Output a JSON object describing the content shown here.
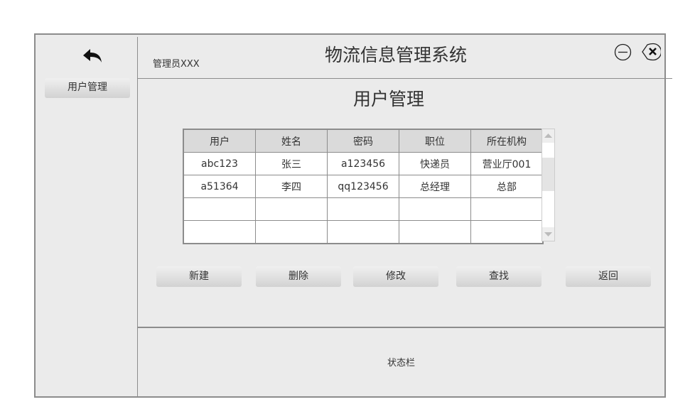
{
  "header": {
    "title": "物流信息管理系统",
    "admin": "管理员XXX"
  },
  "sidebar": {
    "items": [
      {
        "label": "用户管理"
      }
    ]
  },
  "page_title": "用户管理",
  "table": {
    "columns": [
      "用户",
      "姓名",
      "密码",
      "职位",
      "所在机构"
    ],
    "rows": [
      [
        "abc123",
        "张三",
        "a123456",
        "快递员",
        "营业厅001"
      ],
      [
        "a51364",
        "李四",
        "qq123456",
        "总经理",
        "总部"
      ],
      [
        "",
        "",
        "",
        "",
        ""
      ],
      [
        "",
        "",
        "",
        "",
        ""
      ]
    ]
  },
  "buttons": {
    "new": "新建",
    "delete": "删除",
    "edit": "修改",
    "search": "查找",
    "back": "返回"
  },
  "status_bar": "状态栏"
}
